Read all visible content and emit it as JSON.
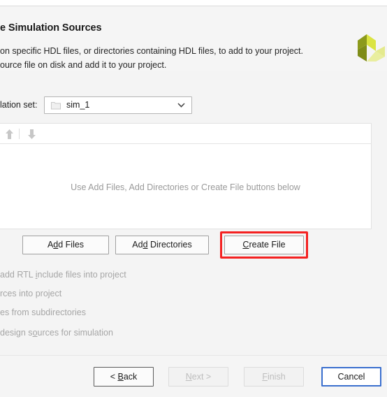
{
  "dialog": {
    "header": {
      "title": "e Simulation Sources",
      "line1": "on specific HDL files, or directories containing HDL files, to add to your project.",
      "line2": "ource file on disk and add it to your project.",
      "logo_icon": "xilinx-pinwheel-logo"
    },
    "simulation_set": {
      "label": "lation set:",
      "value": "sim_1",
      "folder_icon": "folder-icon",
      "dropdown_icon": "chevron-down-icon"
    },
    "file_panel": {
      "toolbar": {
        "move_up_icon": "arrow-up-icon",
        "move_down_icon": "arrow-down-icon"
      },
      "empty_message": "Use Add Files, Add Directories or Create File buttons below"
    },
    "actions": {
      "add_files": {
        "pre": "A",
        "mnemonic": "d",
        "post": "d Files"
      },
      "add_directories": {
        "pre": "Ad",
        "mnemonic": "d",
        "post": " Directories"
      },
      "create_file": {
        "pre": "",
        "mnemonic": "C",
        "post": "reate File"
      },
      "highlight_color": "#f42121"
    },
    "checkboxes": [
      {
        "pre": "add RTL ",
        "mnemonic": "i",
        "post": "nclude files into project"
      },
      {
        "pre": "rces into project",
        "mnemonic": "",
        "post": ""
      },
      {
        "pre": "es from subdirectories",
        "mnemonic": "",
        "post": ""
      },
      {
        "pre": " design s",
        "mnemonic": "o",
        "post": "urces for simulation"
      }
    ],
    "footer": {
      "back": {
        "pre": "< ",
        "mnemonic": "B",
        "post": "ack"
      },
      "next": {
        "pre": "",
        "mnemonic": "N",
        "post": "ext >"
      },
      "finish": {
        "pre": "",
        "mnemonic": "F",
        "post": "inish"
      },
      "cancel": {
        "pre": "Cancel",
        "mnemonic": "",
        "post": ""
      }
    }
  }
}
